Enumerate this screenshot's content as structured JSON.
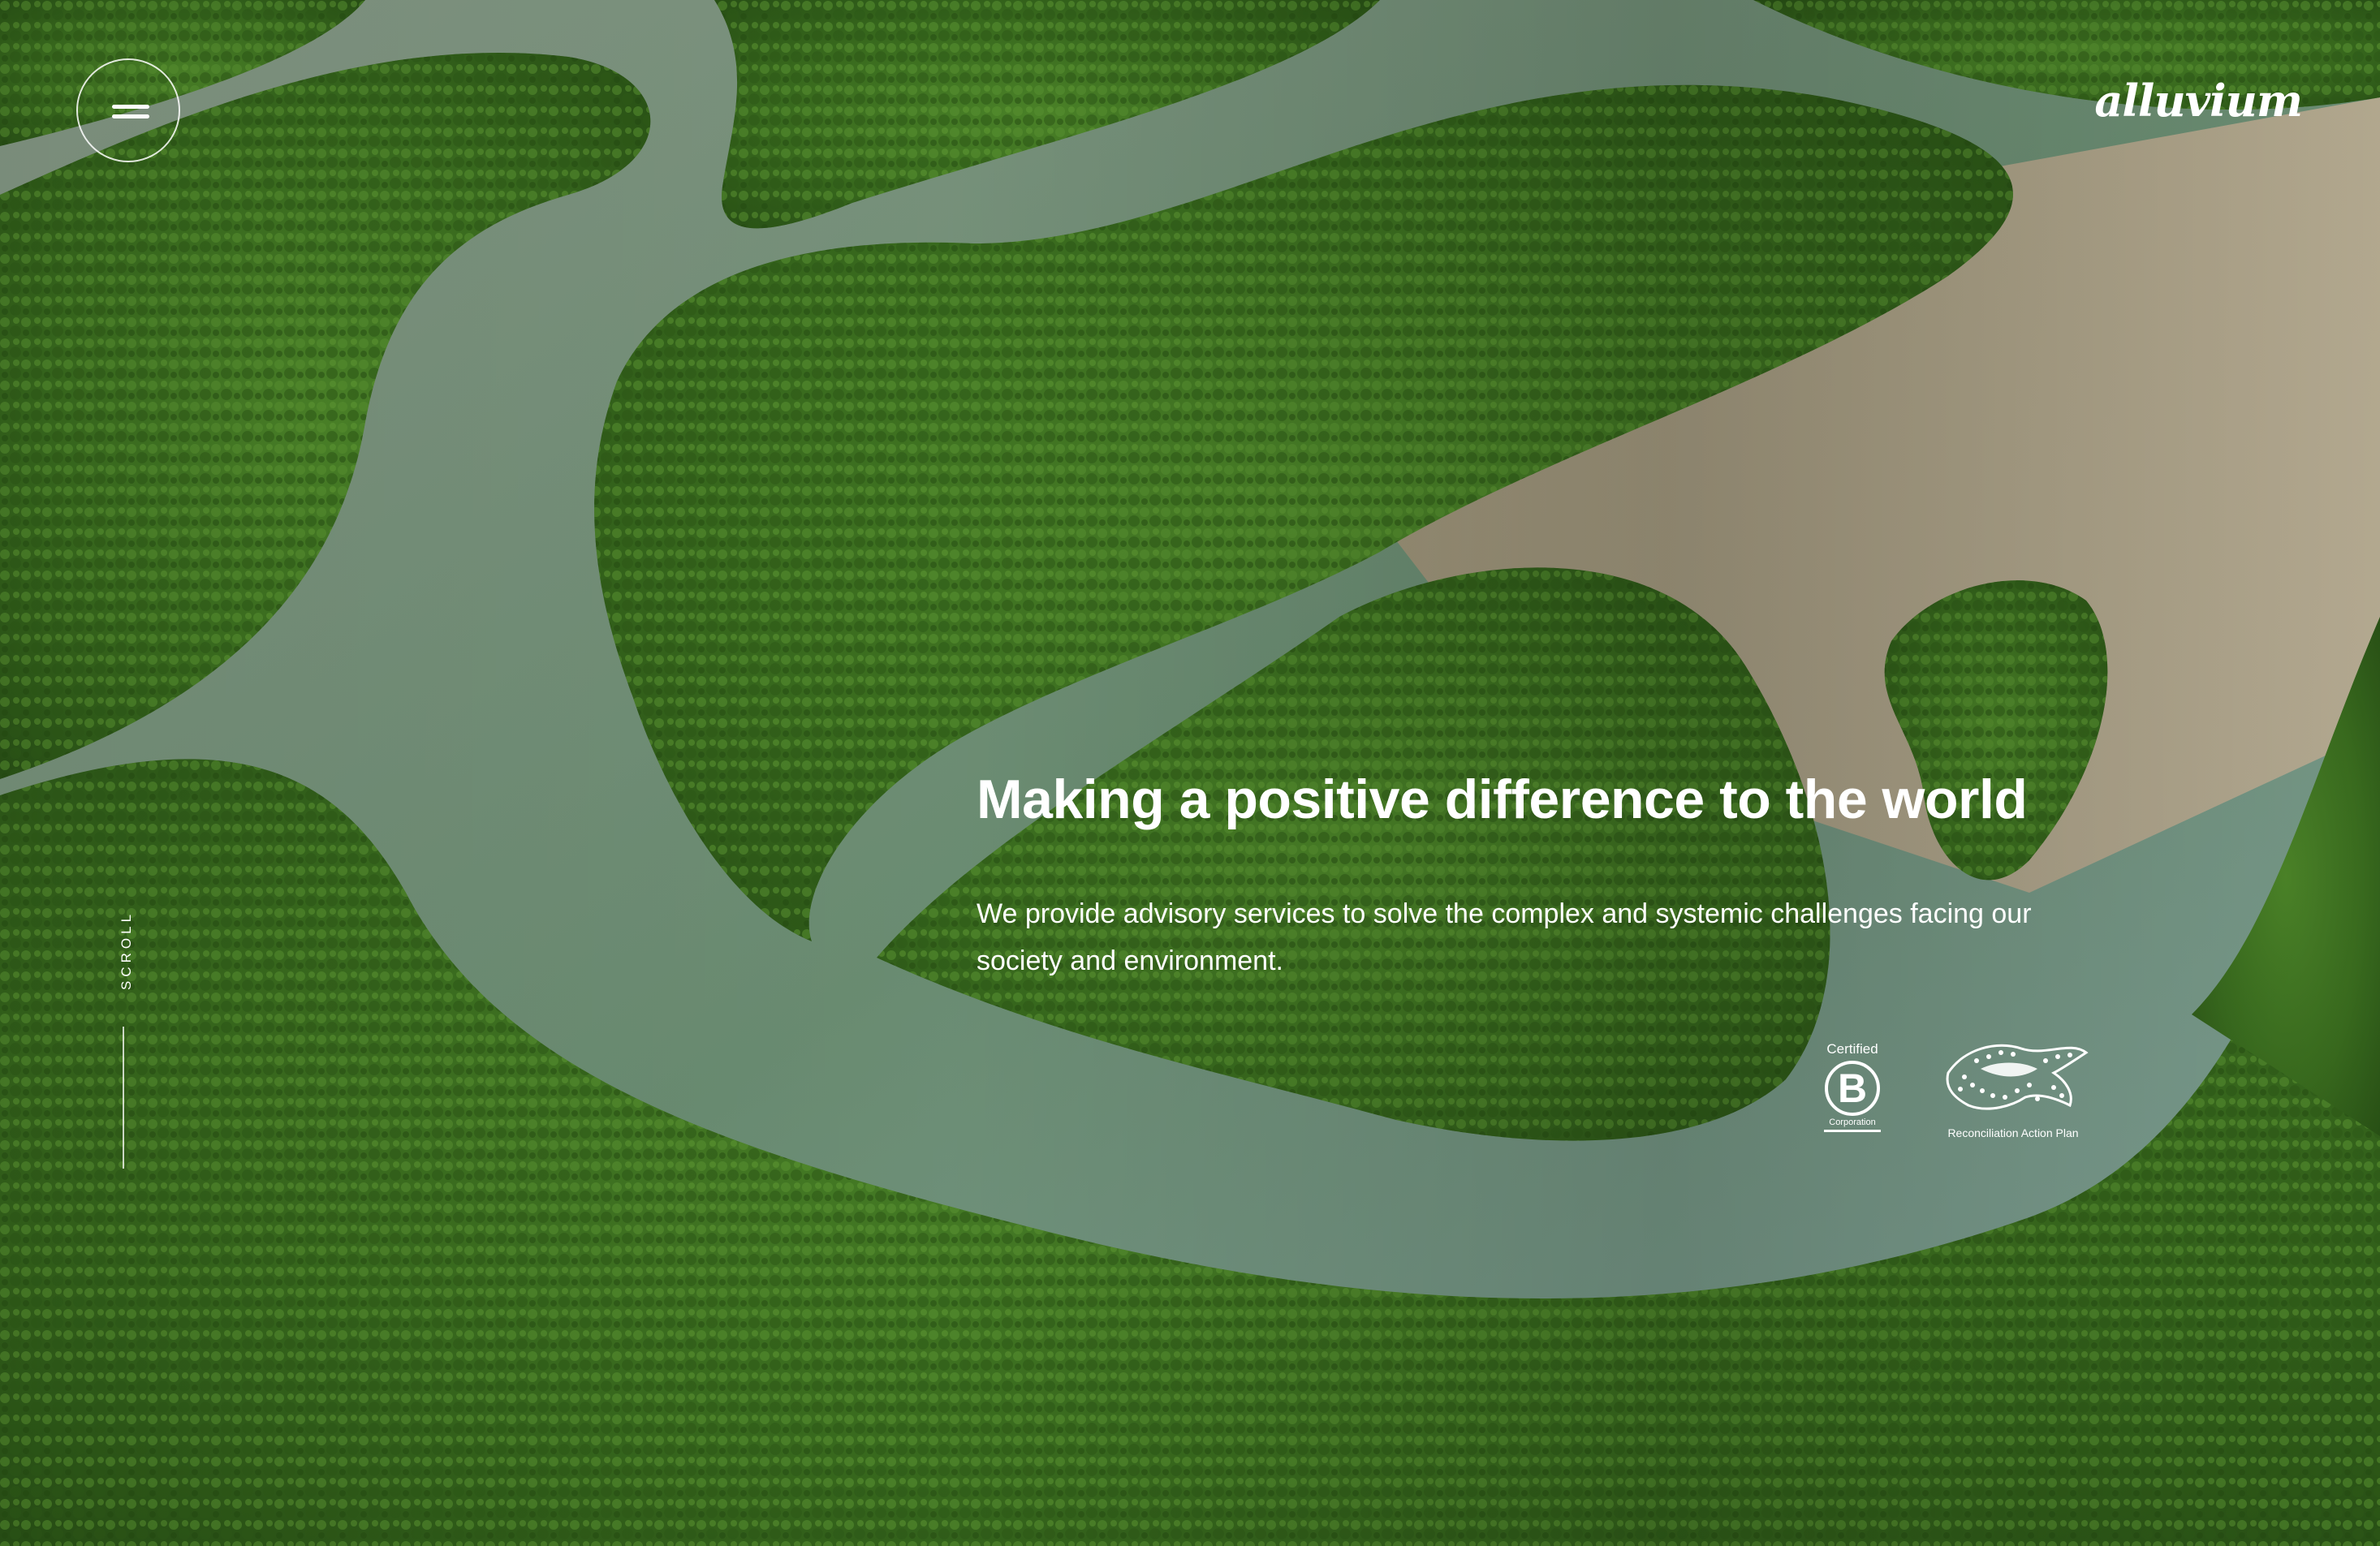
{
  "header": {
    "logo_text": "alluvium",
    "menu_icon": "hamburger-menu-icon"
  },
  "scroll": {
    "label": "SCROLL"
  },
  "hero": {
    "title": "Making a positive difference to the world",
    "text": "We provide advisory services to solve the complex and systemic challenges facing our society and environment."
  },
  "badges": {
    "bcorp": {
      "top_label": "Certified",
      "letter": "B",
      "bottom_label": "Corporation"
    },
    "rap": {
      "label": "Reconciliation Action Plan",
      "icon": "reconciliation-action-plan-logo"
    }
  },
  "colors": {
    "forest": "#3d7420",
    "water": "#7a9a86",
    "sand": "#b9a68c",
    "text": "#ffffff"
  }
}
